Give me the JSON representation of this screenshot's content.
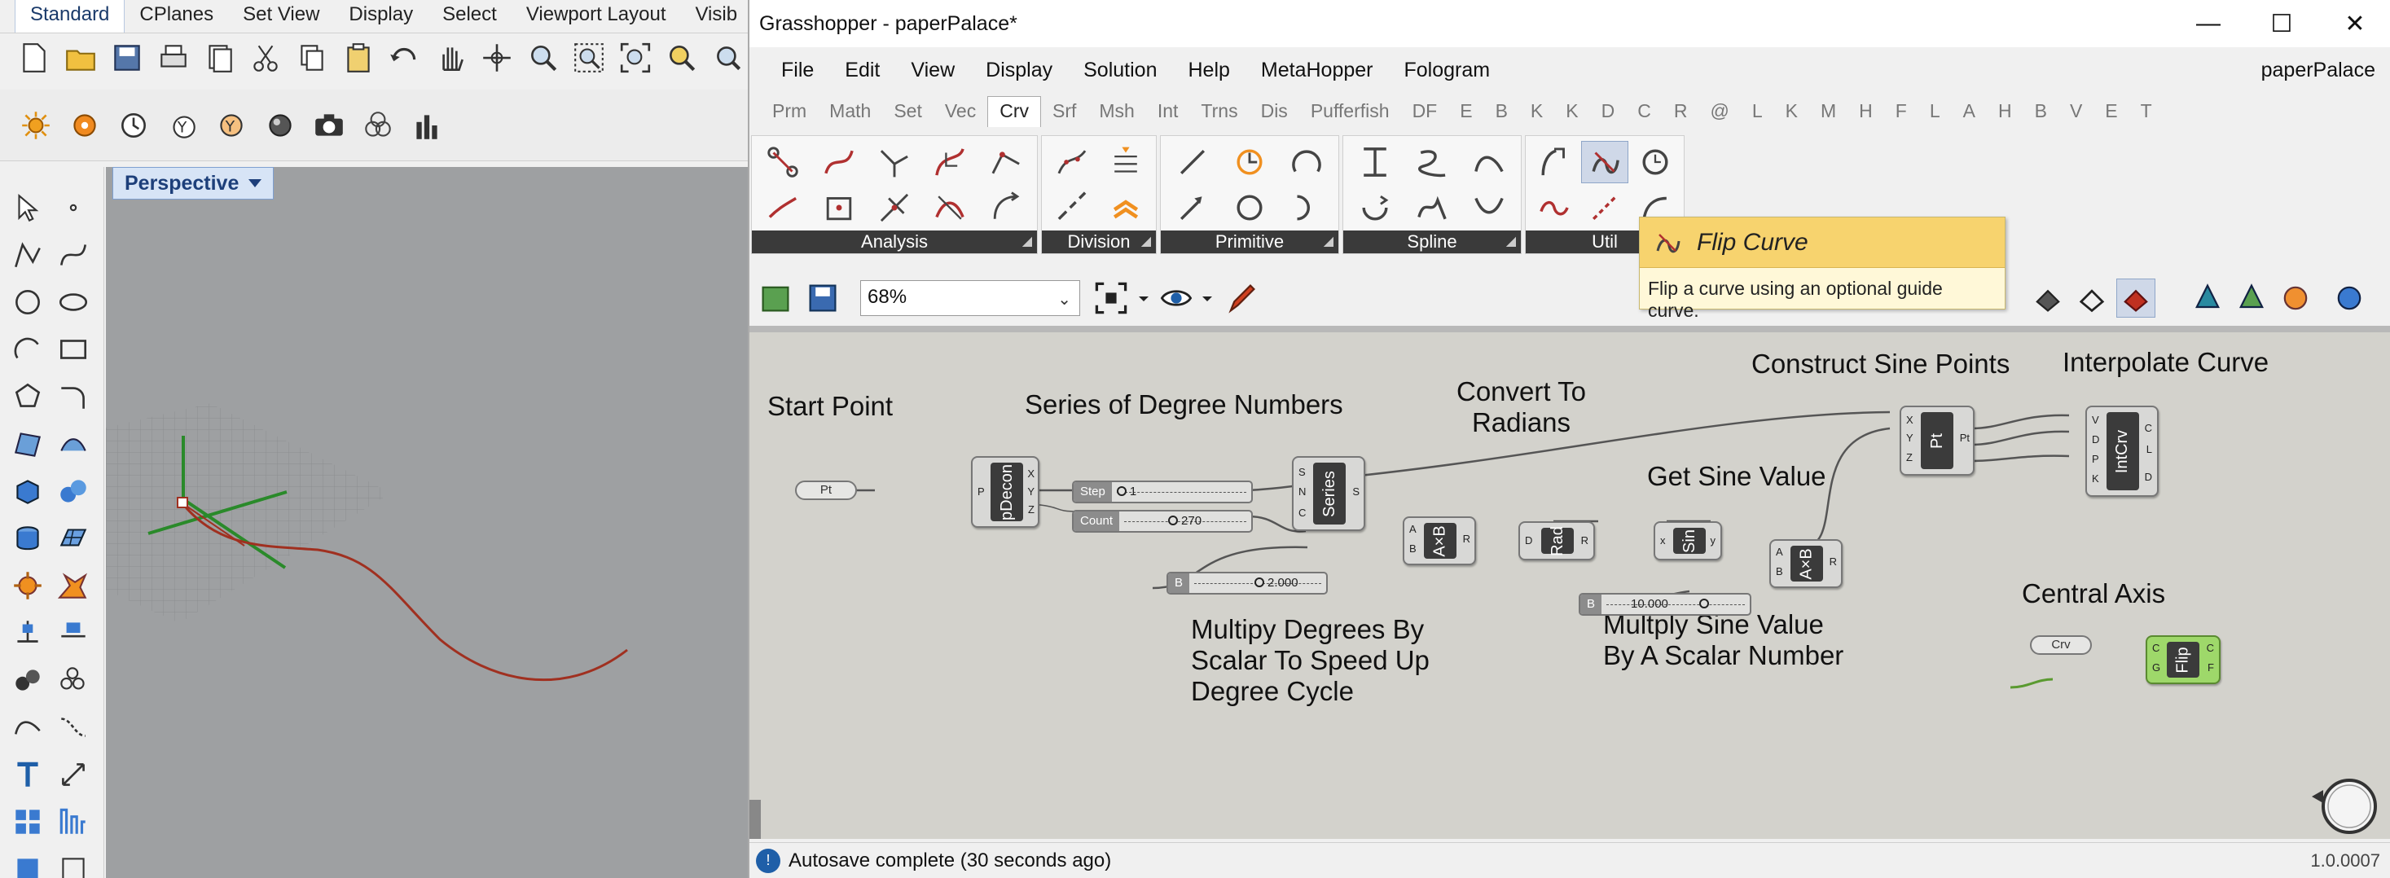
{
  "rhino": {
    "tabs": [
      "Standard",
      "CPlanes",
      "Set View",
      "Display",
      "Select",
      "Viewport Layout",
      "Visib"
    ],
    "active_tab": "Standard",
    "viewport_title": "Perspective"
  },
  "gh": {
    "title": "Grasshopper - paperPalace*",
    "document_name": "paperPalace",
    "window_buttons": {
      "minimize": "—",
      "maximize": "☐",
      "close": "✕"
    },
    "menu": [
      "File",
      "Edit",
      "View",
      "Display",
      "Solution",
      "Help",
      "MetaHopper",
      "Fologram"
    ],
    "category_tabs": [
      "Prm",
      "Math",
      "Set",
      "Vec",
      "Crv",
      "Srf",
      "Msh",
      "Int",
      "Trns",
      "Dis",
      "Pufferfish",
      "DF",
      "E",
      "B",
      "K",
      "K",
      "D",
      "C",
      "R",
      "@",
      "L",
      "K",
      "M",
      "H",
      "F",
      "L",
      "A",
      "H",
      "B",
      "V",
      "E",
      "T"
    ],
    "active_category": "Crv",
    "groups": [
      {
        "label": "Analysis"
      },
      {
        "label": "Division"
      },
      {
        "label": "Primitive"
      },
      {
        "label": "Spline"
      },
      {
        "label": "Util"
      }
    ],
    "group_more": "◢",
    "tooltip": {
      "title": "Flip Curve",
      "description": "Flip a curve using an optional guide curve."
    },
    "zoom": "68%",
    "canvas": {
      "labels": {
        "start_point": "Start Point",
        "series": "Series of Degree Numbers",
        "convert": "Convert To\nRadians",
        "get_sine": "Get Sine Value",
        "construct": "Construct Sine Points",
        "interpolate": "Interpolate Curve",
        "multiply_degrees": "Multipy Degrees By\nScalar To Speed Up\nDegree Cycle",
        "multiply_sine": "Multply Sine Value\nBy A Scalar Number",
        "central_axis": "Central Axis"
      },
      "components": {
        "pt_param": "Pt",
        "pdecon": "pDecon",
        "series": "Series",
        "axb1": "A×B",
        "rad": "Rad",
        "sin": "Sin",
        "axb2": "A×B",
        "pt_construct": "Pt",
        "intcrv": "IntCrv",
        "crv_param": "Crv",
        "flip": "Flip"
      },
      "sliders": {
        "step": {
          "label": "Step",
          "value": "1"
        },
        "count": {
          "label": "Count",
          "value": "270"
        },
        "b1": {
          "label": "B",
          "value": "2.000"
        },
        "b2": {
          "label": "B",
          "value": "10.000"
        }
      }
    },
    "status": {
      "text": "Autosave complete (30 seconds ago)",
      "version": "1.0.0007"
    }
  }
}
